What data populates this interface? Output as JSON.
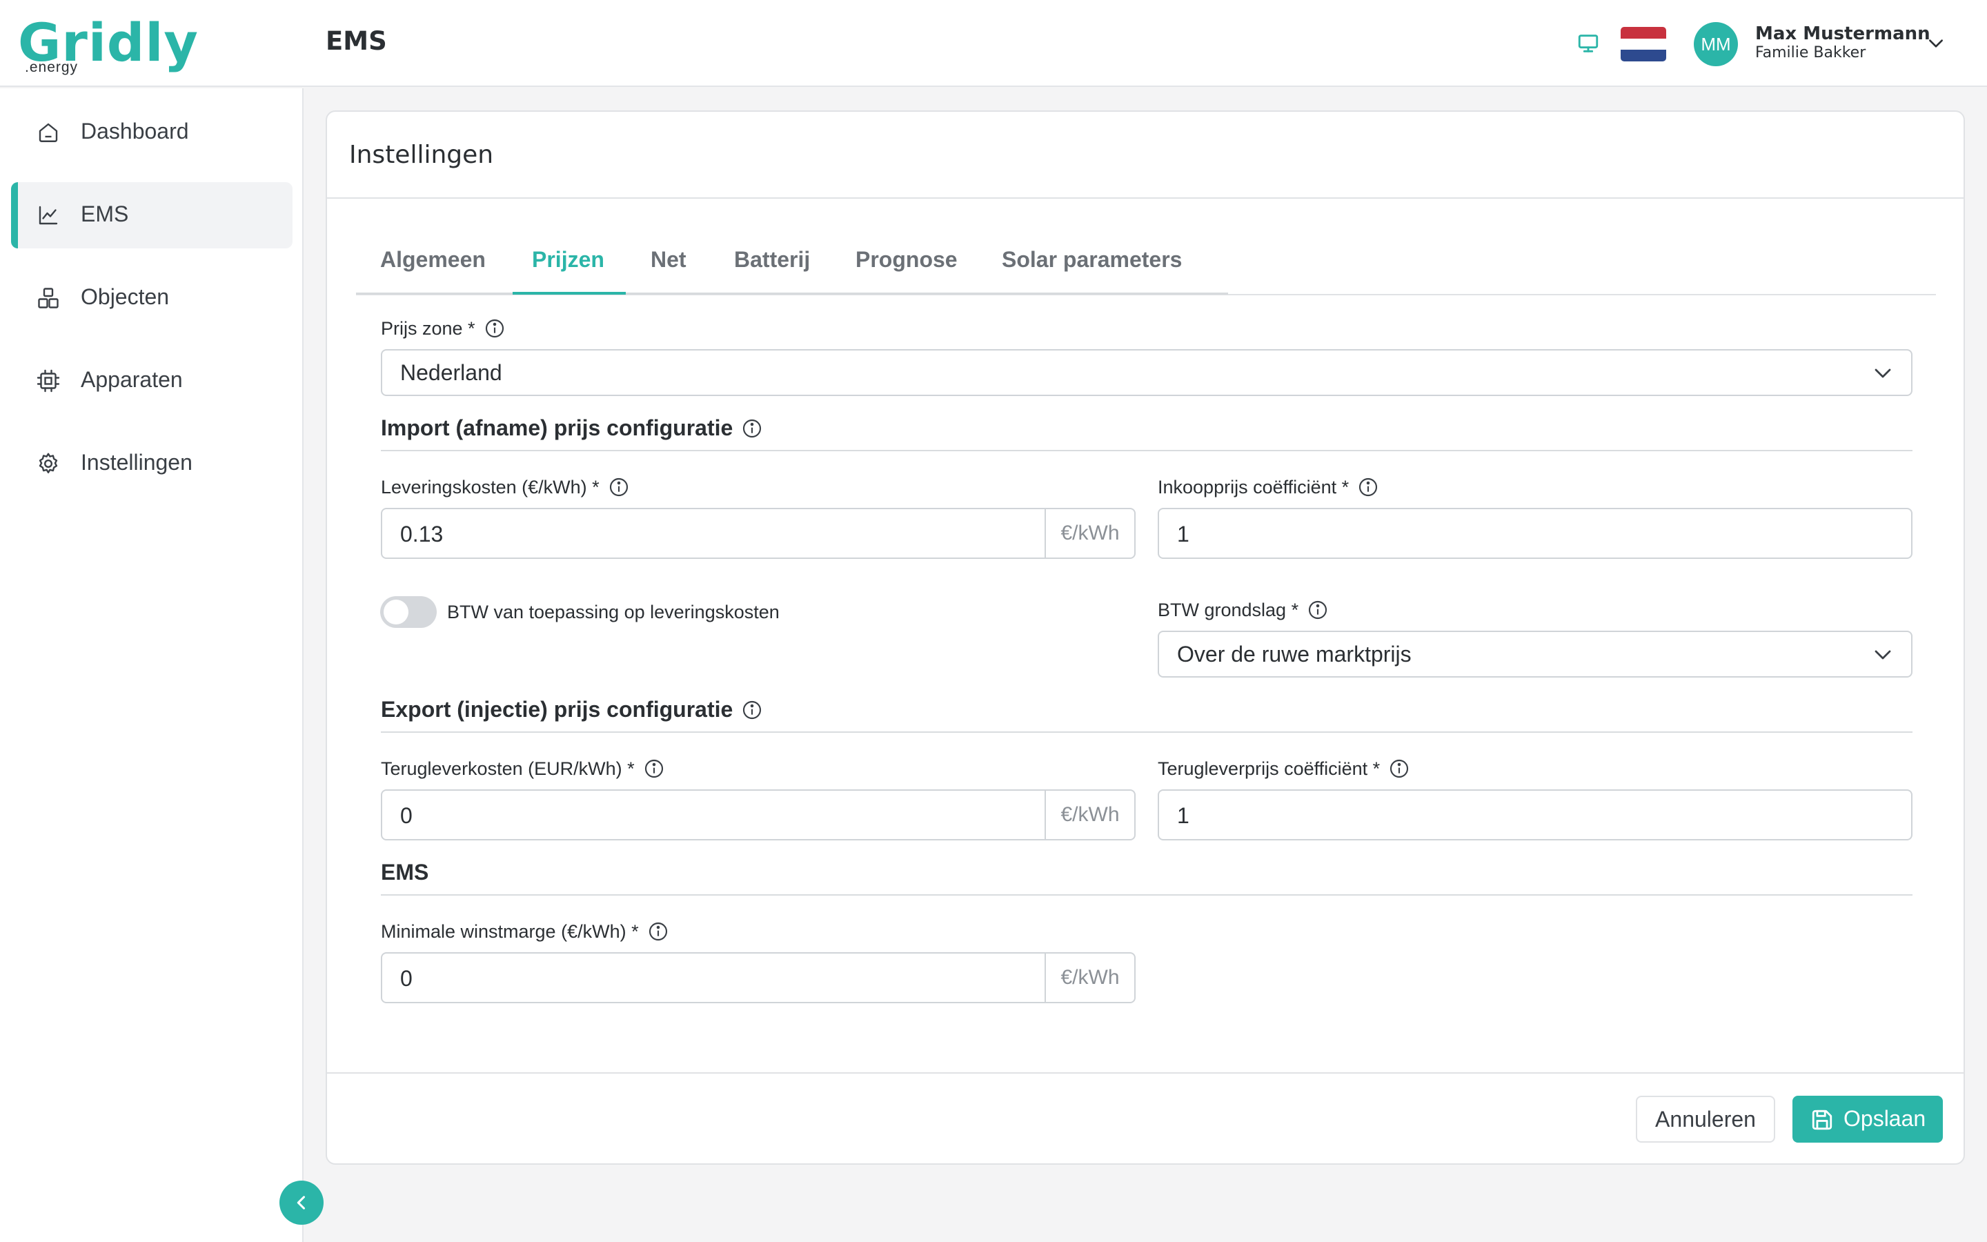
{
  "app": {
    "logo_word": "Gridly",
    "logo_sub": ".energy",
    "header_title": "EMS"
  },
  "user": {
    "initials": "MM",
    "name": "Max Mustermann",
    "subtitle": "Familie Bakker"
  },
  "icons": {
    "monitor": "monitor-icon",
    "flag": "netherlands-flag",
    "chevron": "chevron-down-icon"
  },
  "colors": {
    "accent": "#2bb5a8",
    "flag_red": "#c8313e",
    "flag_white": "#ffffff",
    "flag_blue": "#2d4a8f"
  },
  "sidebar": {
    "items": [
      {
        "label": "Dashboard",
        "icon": "home-icon",
        "active": false
      },
      {
        "label": "EMS",
        "icon": "chart-line-icon",
        "active": true
      },
      {
        "label": "Objecten",
        "icon": "objects-icon",
        "active": false
      },
      {
        "label": "Apparaten",
        "icon": "chip-icon",
        "active": false
      },
      {
        "label": "Instellingen",
        "icon": "gear-icon",
        "active": false
      }
    ]
  },
  "card": {
    "title": "Instellingen",
    "tabs": [
      {
        "label": "Algemeen",
        "active": false
      },
      {
        "label": "Prijzen",
        "active": true
      },
      {
        "label": "Net",
        "active": false
      },
      {
        "label": "Batterij",
        "active": false
      },
      {
        "label": "Prognose",
        "active": false
      },
      {
        "label": "Solar parameters",
        "active": false
      }
    ]
  },
  "form": {
    "price_zone": {
      "label": "Prijs zone *",
      "value": "Nederland"
    },
    "import_section": "Import (afname) prijs configuratie",
    "delivery_costs": {
      "label": "Leveringskosten (€/kWh) *",
      "value": "0.13",
      "unit": "€/kWh"
    },
    "purchase_coefficient": {
      "label": "Inkoopprijs coëfficiënt *",
      "value": "1"
    },
    "vat_toggle": {
      "label": "BTW van toepassing op leveringskosten",
      "on": false
    },
    "vat_basis": {
      "label": "BTW grondslag *",
      "value": "Over de ruwe marktprijs"
    },
    "export_section": "Export (injectie) prijs configuratie",
    "feedin_costs": {
      "label": "Terugleverkosten (EUR/kWh) *",
      "value": "0",
      "unit": "€/kWh"
    },
    "feedin_coefficient": {
      "label": "Terugleverprijs coëfficiënt *",
      "value": "1"
    },
    "ems_section": "EMS",
    "min_margin": {
      "label": "Minimale winstmarge (€/kWh) *",
      "value": "0",
      "unit": "€/kWh"
    }
  },
  "actions": {
    "cancel_label": "Annuleren",
    "save_label": "Opslaan"
  }
}
